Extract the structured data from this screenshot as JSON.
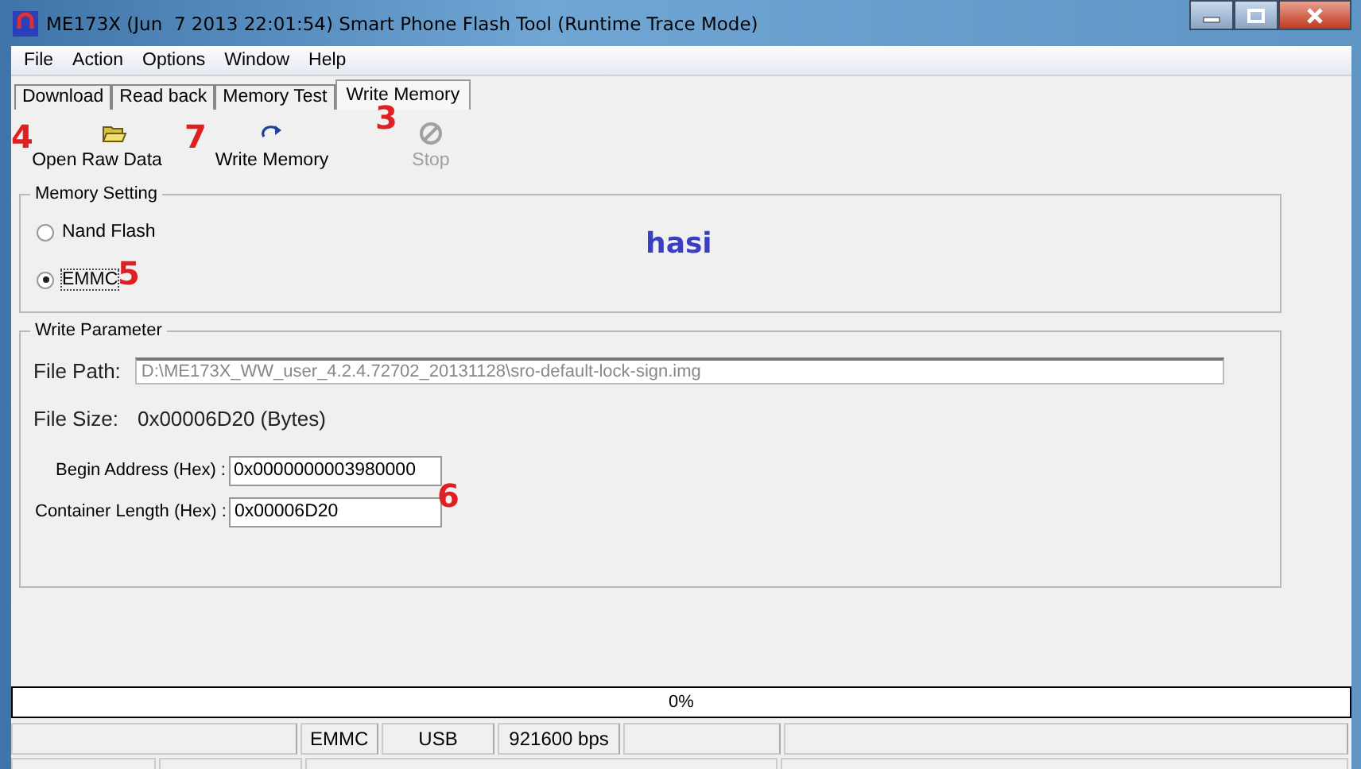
{
  "window": {
    "title": "ME173X (Jun  7 2013 22:01:54) Smart Phone Flash Tool (Runtime Trace Mode)"
  },
  "menu": [
    "File",
    "Action",
    "Options",
    "Window",
    "Help"
  ],
  "tabs": [
    {
      "label": "Download",
      "selected": false
    },
    {
      "label": "Read back",
      "selected": false
    },
    {
      "label": "Memory Test",
      "selected": false
    },
    {
      "label": "Write Memory",
      "selected": true
    }
  ],
  "toolbar": [
    {
      "kind": "open",
      "label": "Open Raw Data",
      "disabled": false
    },
    {
      "kind": "write",
      "label": "Write Memory",
      "disabled": false
    },
    {
      "kind": "stop",
      "label": "Stop",
      "disabled": true
    }
  ],
  "memory_setting": {
    "title": "Memory Setting",
    "options": [
      {
        "label": "Nand Flash",
        "selected": false
      },
      {
        "label": "EMMC",
        "selected": true
      }
    ]
  },
  "write_parameter": {
    "title": "Write Parameter",
    "file_path_label": "File Path:",
    "file_path": "D:\\ME173X_WW_user_4.2.4.72702_20131128\\sro-default-lock-sign.img",
    "file_size_label": "File Size:",
    "file_size": "0x00006D20  (Bytes)",
    "fields": [
      {
        "label": "Begin Address (Hex) :",
        "value": "0x0000000003980000"
      },
      {
        "label": "Container Length (Hex) :",
        "value": "0x00006D20"
      }
    ]
  },
  "progress": {
    "level": 0,
    "text": "0%"
  },
  "status_bar": [
    "EMMC",
    "USB",
    "921600 bps"
  ],
  "annotations": [
    {
      "kind": "number",
      "text": "4",
      "color": "#e02020"
    },
    {
      "kind": "number",
      "text": "7",
      "color": "#e02020"
    },
    {
      "kind": "number",
      "text": "3",
      "color": "#e02020"
    },
    {
      "kind": "number",
      "text": "5",
      "color": "#e02020"
    },
    {
      "kind": "number",
      "text": "6",
      "color": "#e02020"
    },
    {
      "kind": "word",
      "text": "hasi",
      "color": "#3a3ec0"
    }
  ]
}
